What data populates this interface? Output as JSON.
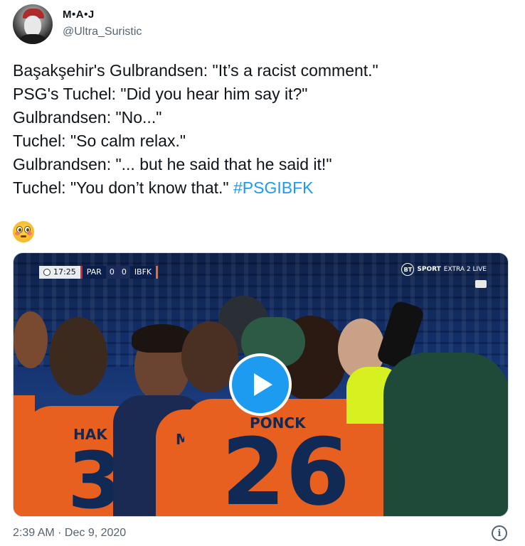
{
  "author": {
    "display_name": "M•A•J",
    "handle": "@Ultra_Suristic"
  },
  "tweet": {
    "lines": [
      "Başakşehir's Gulbrandsen: \"It’s a racist comment.\"",
      "PSG's Tuchel: \"Did you hear him say it?\"",
      "Gulbrandsen: \"No...\"",
      "Tuchel: \"So calm relax.\"",
      "Gulbrandsen: \"... but he said that he said it!\"",
      "Tuchel: \"You don’t know that.\""
    ],
    "hashtag": "#PSGIBFK",
    "emoji": "flushed-face-emoji"
  },
  "video": {
    "scorebug": {
      "clock": "17:25",
      "home_team": "PAR",
      "home_score": "0",
      "away_score": "0",
      "away_team": "IBFK"
    },
    "channel": {
      "logo": "BT",
      "name": "SPORT",
      "sub": "EXTRA 2 LIVE"
    },
    "jerseys": [
      {
        "name": "HAK",
        "number": "3"
      },
      {
        "name": "MAH",
        "number": ""
      },
      {
        "name": "PONCK",
        "number": "26"
      }
    ],
    "play_button": "play-icon"
  },
  "meta": {
    "timestamp": "2:39 AM · Dec 9, 2020",
    "info_icon": "info-icon"
  },
  "colors": {
    "hashtag": "#1d9bf0",
    "secondary_text": "#536471",
    "jersey_orange": "#e8601f"
  }
}
